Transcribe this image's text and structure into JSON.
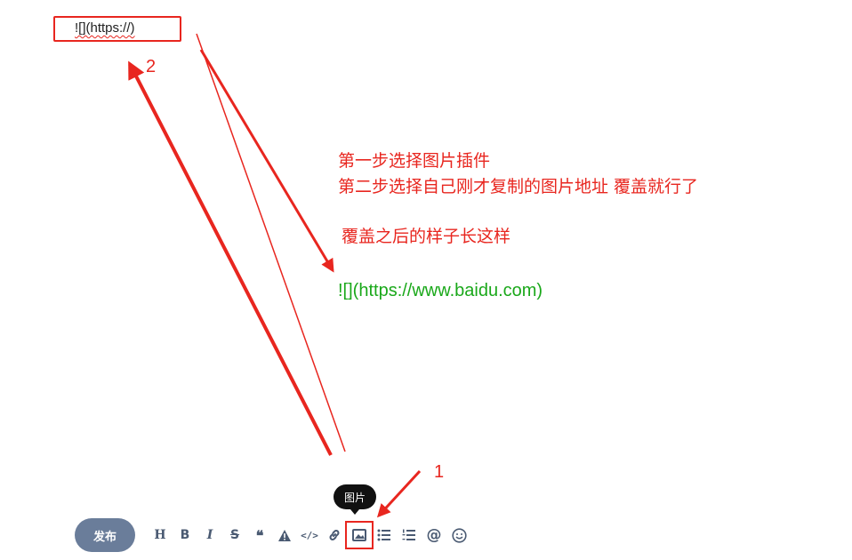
{
  "snippet": {
    "text": "![](https://)"
  },
  "markers": {
    "step1": "1",
    "step2": "2"
  },
  "notes": {
    "line1": "第一步选择图片插件",
    "line2": "第二步选择自己刚才复制的图片地址 覆盖就行了",
    "line3": "覆盖之后的样子长这样"
  },
  "example": {
    "text": "![](https://www.baidu.com)"
  },
  "tooltip": {
    "text": "图片"
  },
  "toolbar": {
    "publish_label": "发布",
    "tools": [
      {
        "label": "H",
        "icon": "heading-icon"
      },
      {
        "label": "B",
        "icon": "bold-icon"
      },
      {
        "label": "I",
        "icon": "italic-icon"
      },
      {
        "label": "S",
        "icon": "strikethrough-icon"
      },
      {
        "label": "❝",
        "icon": "quote-icon"
      },
      {
        "label": "",
        "icon": "warning-icon"
      },
      {
        "label": "</>",
        "icon": "code-icon"
      },
      {
        "label": "",
        "icon": "link-icon"
      },
      {
        "label": "",
        "icon": "image-icon"
      },
      {
        "label": "",
        "icon": "bullet-list-icon"
      },
      {
        "label": "",
        "icon": "numbered-list-icon"
      },
      {
        "label": "@",
        "icon": "mention-icon"
      },
      {
        "label": "",
        "icon": "emoji-icon"
      }
    ]
  },
  "colors": {
    "annotation": "#e8261f",
    "example_text": "#1aa81a",
    "publish_button": "#6a7d9a",
    "icon": "#4a5a72"
  }
}
